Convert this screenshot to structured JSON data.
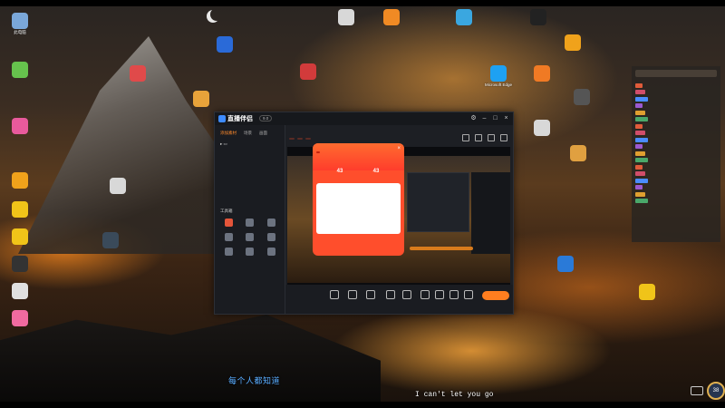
{
  "desktop": {
    "icons": [
      {
        "label": "此电脑",
        "color": "#7aa7d9"
      },
      {
        "label": "",
        "color": "#66c24d"
      },
      {
        "label": "",
        "color": "#e85a9c"
      },
      {
        "label": "",
        "color": "#f0a21b"
      },
      {
        "label": "",
        "color": "#f0c419"
      },
      {
        "label": "",
        "color": "#f0c419"
      },
      {
        "label": "",
        "color": "#333333"
      },
      {
        "label": "",
        "color": "#e0e0e0"
      },
      {
        "label": "",
        "color": "#f06aa0"
      },
      {
        "label": "",
        "color": "#d8d8d8"
      },
      {
        "label": "",
        "color": "#3a4a5a"
      },
      {
        "label": "",
        "color": "#e04a4a"
      },
      {
        "label": "",
        "color": "#e8a33a"
      },
      {
        "label": "",
        "color": "#d23b3b"
      },
      {
        "label": "",
        "color": "#2a6ad8"
      },
      {
        "label": "",
        "color": "#d8d8d8"
      },
      {
        "label": "",
        "color": "#f08a24"
      },
      {
        "label": "",
        "color": "#3aa7e0"
      },
      {
        "label": "Microsoft Edge",
        "color": "#1ea1f2"
      },
      {
        "label": "",
        "color": "#f07a24"
      },
      {
        "label": "",
        "color": "#222222"
      },
      {
        "label": "",
        "color": "#d8d8d8"
      },
      {
        "label": "",
        "color": "#2a7ad8"
      },
      {
        "label": "",
        "color": "#f0a21b"
      },
      {
        "label": "",
        "color": "#e0a040"
      },
      {
        "label": "",
        "color": "#555555"
      },
      {
        "label": "",
        "color": "#f0c419"
      }
    ]
  },
  "app": {
    "name": "直播伴侣",
    "version": "9.0",
    "tabs": [
      "添加素材",
      "场景",
      "画面"
    ],
    "tools_title": "工具箱",
    "tools": [
      "",
      "",
      "",
      "",
      "",
      "",
      "",
      "",
      ""
    ],
    "footer": "",
    "scene_title": "",
    "tags": [
      "",
      "",
      ""
    ],
    "stats": [
      "",
      "",
      ""
    ],
    "bottom_items": [
      "",
      "",
      "",
      "",
      "",
      "",
      "",
      "",
      ""
    ],
    "live_button": "",
    "bottom_small": ""
  },
  "popup": {
    "title": "",
    "badge": "",
    "stats": [
      {
        "value": "43",
        "label": ""
      },
      {
        "value": "43",
        "label": ""
      }
    ],
    "card_title": "",
    "card_row": "",
    "card_tag": "",
    "footer": ""
  },
  "chat": {
    "rows": [
      "",
      "",
      "",
      "",
      "",
      "",
      "",
      "",
      "",
      "",
      "",
      "",
      "",
      "",
      "",
      "",
      "",
      ""
    ],
    "bottom": ""
  },
  "lyrics": {
    "chinese": "每个人都知道",
    "english": "I can't let you go"
  },
  "tray": {
    "badge": "38"
  }
}
